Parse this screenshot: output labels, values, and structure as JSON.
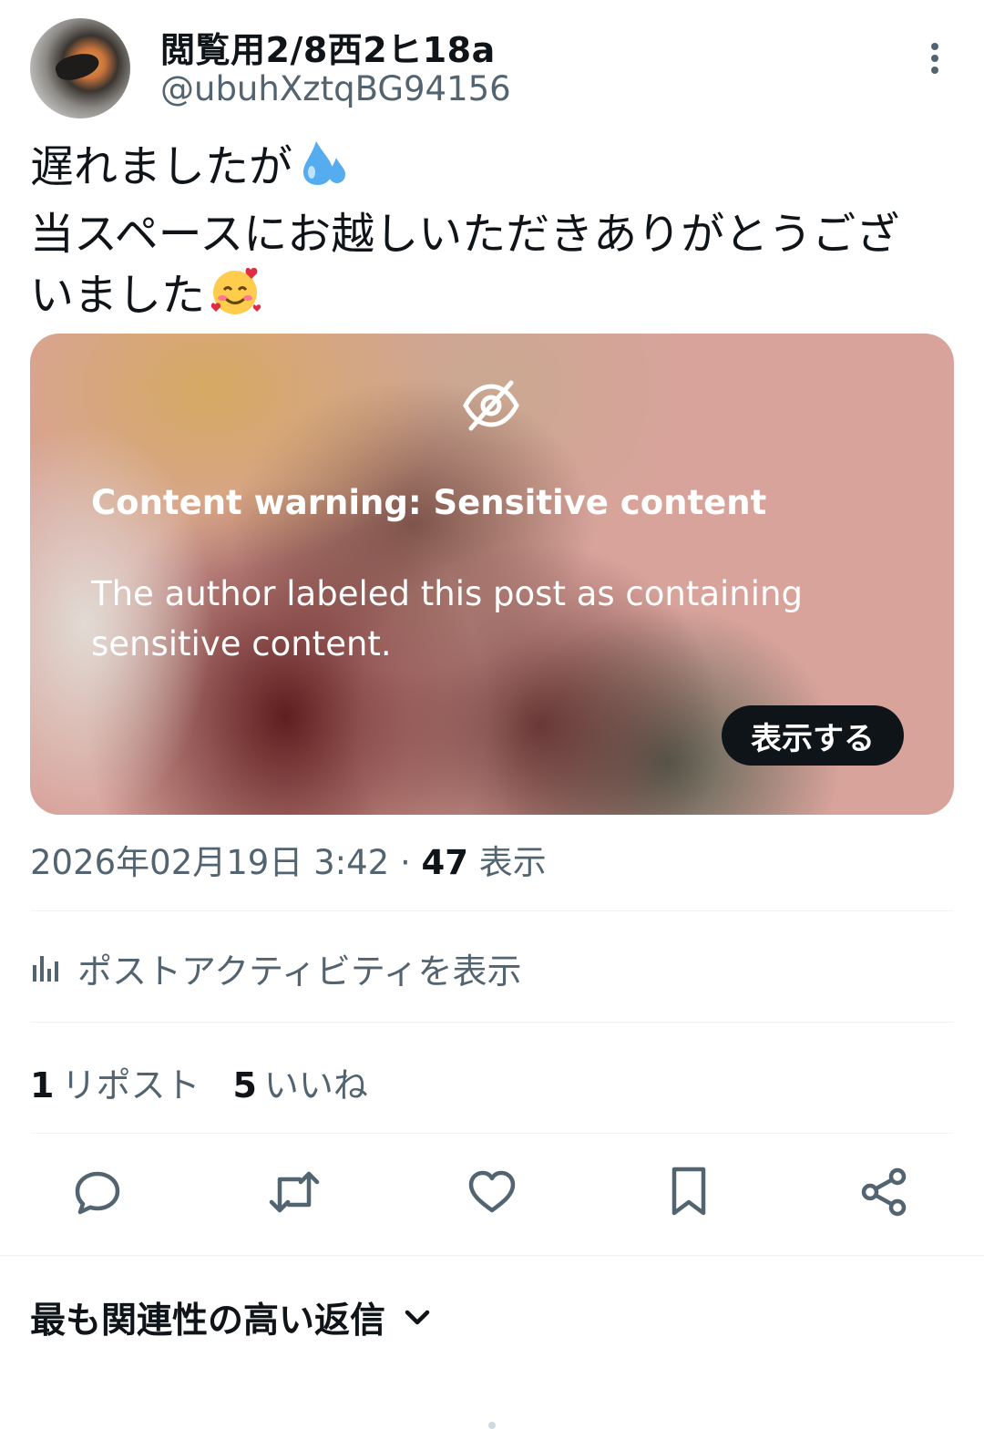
{
  "author": {
    "display_name": "閲覧用2/8西2ヒ18a",
    "handle": "@ubuhXztqBG94156",
    "avatar_icon": "profile-photo"
  },
  "tweet": {
    "line1": "遅れましたが",
    "line1_emoji": "sweat-droplets-emoji",
    "line2": "当スペースにお越しいただきありがとうござ",
    "line3": "いました",
    "line3_emoji": "smiling-face-with-hearts-emoji"
  },
  "media": {
    "warning_title": "Content warning: Sensitive content",
    "warning_body": "The author labeled this post as containing sensitive content.",
    "show_button": "表示する"
  },
  "meta": {
    "timestamp": "2026年02月19日 3:42",
    "separator": "·",
    "views_count": "47",
    "views_label": "表示"
  },
  "activity_link": "ポストアクティビティを表示",
  "stats": {
    "reposts_count": "1",
    "reposts_label": "リポスト",
    "likes_count": "5",
    "likes_label": "いいね"
  },
  "replies_sort": "最も関連性の高い返信",
  "colors": {
    "text_primary": "#0f1419",
    "text_secondary": "#536471",
    "divider": "#eff3f4",
    "button_dark": "#0f1419"
  }
}
